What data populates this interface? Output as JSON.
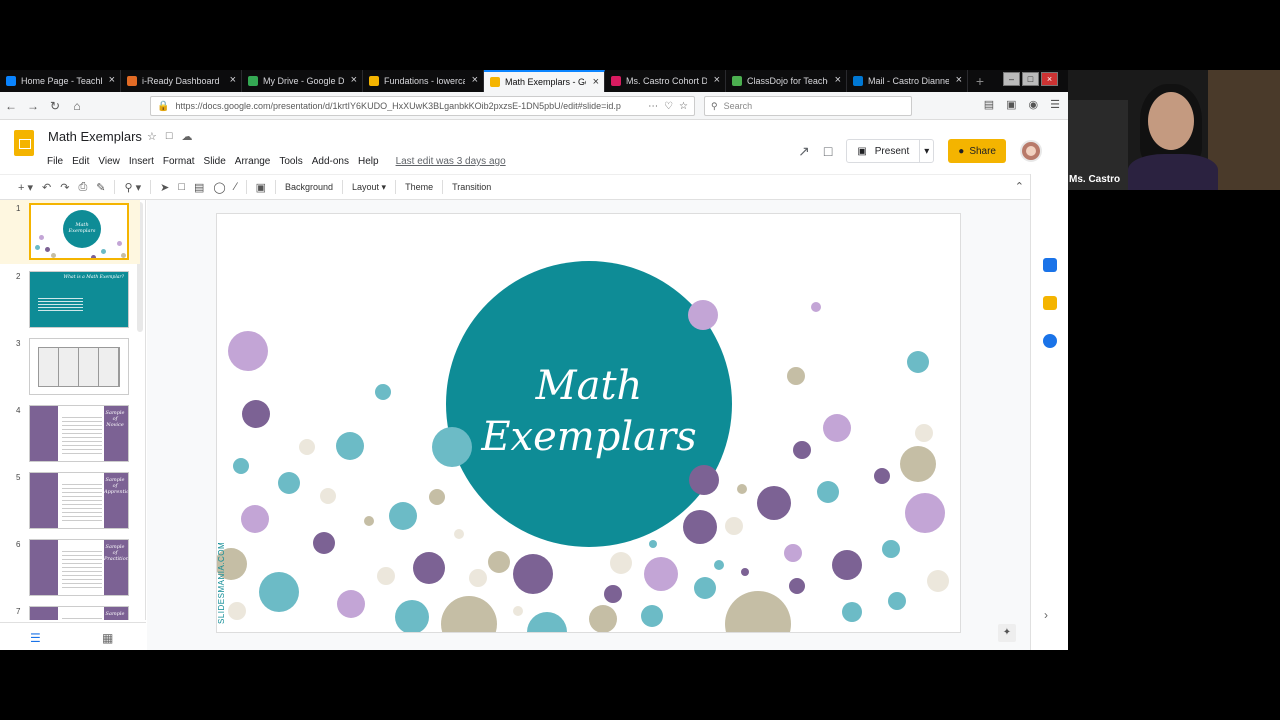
{
  "browser": {
    "tabs": [
      {
        "title": "Home Page - TeachHub",
        "color": "#0a84ff",
        "active": false
      },
      {
        "title": "i-Ready Dashboard",
        "color": "#e26b25",
        "active": false
      },
      {
        "title": "My Drive - Google Drive",
        "color": "#34a853",
        "active": false
      },
      {
        "title": "Fundations - lowercase",
        "color": "#f4b400",
        "active": false
      },
      {
        "title": "Math Exemplars - Google Slides",
        "color": "#f4b400",
        "active": true
      },
      {
        "title": "Ms. Castro Cohort D",
        "color": "#d81b60",
        "active": false
      },
      {
        "title": "ClassDojo for Teachers",
        "color": "#4caf50",
        "active": false
      },
      {
        "title": "Mail - Castro Dianne",
        "color": "#0078d4",
        "active": false
      }
    ],
    "url": "https://docs.google.com/presentation/d/1krtIY6KUDO_HxXUwK3BLganbkKOib2pxzsE-1DN5pbU/edit#slide=id.p",
    "search_placeholder": "Search",
    "new_tab_glyph": "+"
  },
  "slides_app": {
    "doc_title": "Math Exemplars",
    "menus": [
      "File",
      "Edit",
      "View",
      "Insert",
      "Format",
      "Slide",
      "Arrange",
      "Tools",
      "Add-ons",
      "Help"
    ],
    "last_edit": "Last edit was 3 days ago",
    "present_label": "Present",
    "share_label": "Share"
  },
  "toolbar": {
    "background_label": "Background",
    "layout_label": "Layout",
    "theme_label": "Theme",
    "transition_label": "Transition"
  },
  "filmstrip": {
    "slide_numbers": [
      "1",
      "2",
      "3",
      "4",
      "5",
      "6",
      "7"
    ],
    "selected": 1,
    "thumb_texts": [
      "Math Exemplars",
      "What is a Math Exemplar?",
      "",
      "Sample of Novice",
      "Sample of Apprentice",
      "Sample of Practitioner",
      "Sample"
    ]
  },
  "slide": {
    "title_line1": "Math",
    "title_line2": "Exemplars",
    "watermark": "SLIDESMANIA.COM",
    "colors": {
      "teal": "#0e8c96",
      "light_teal": "#6cbbc6",
      "purple": "#7c6294",
      "lavender": "#c3a5d6",
      "tan": "#c5bea5",
      "cream": "#ece7dc"
    }
  },
  "webcam": {
    "name": "Ms. Castro"
  }
}
